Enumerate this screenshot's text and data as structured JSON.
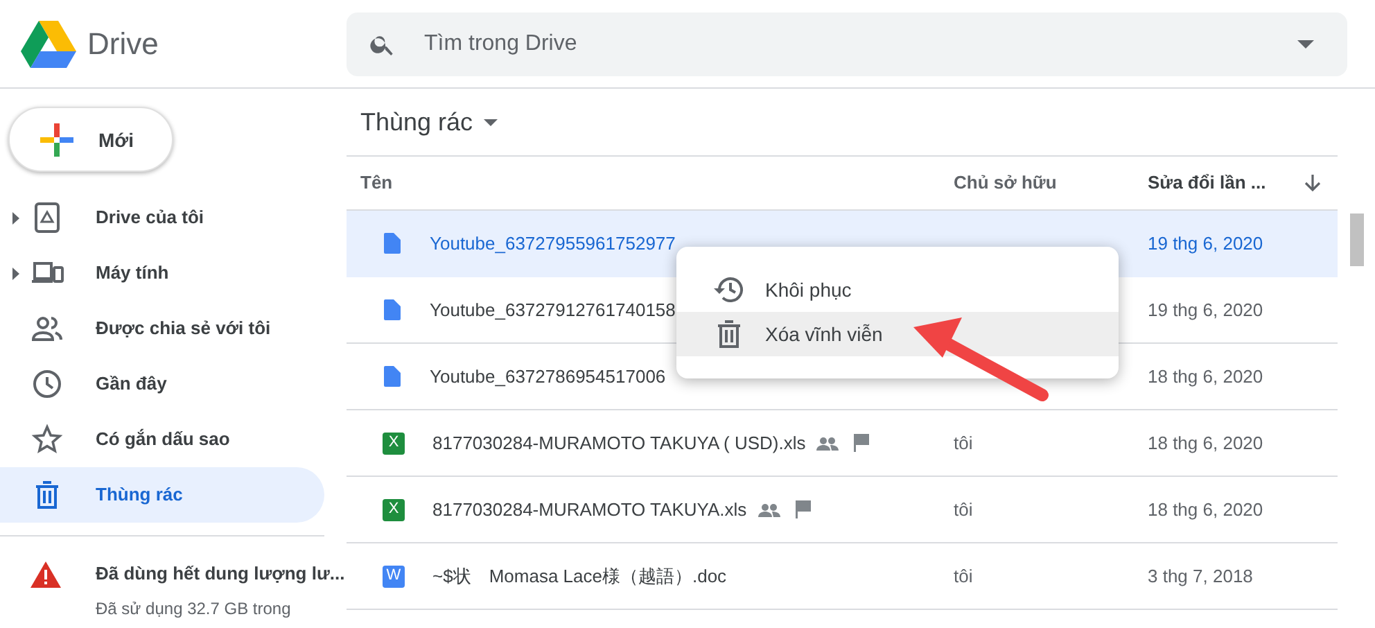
{
  "app": {
    "name": "Drive"
  },
  "search": {
    "placeholder": "Tìm trong Drive"
  },
  "new_button": {
    "label": "Mới"
  },
  "sidebar": {
    "items": [
      {
        "label": "Drive của tôi",
        "expandable": true,
        "selected": false
      },
      {
        "label": "Máy tính",
        "expandable": true,
        "selected": false
      },
      {
        "label": "Được chia sẻ với tôi",
        "expandable": false,
        "selected": false
      },
      {
        "label": "Gần đây",
        "expandable": false,
        "selected": false
      },
      {
        "label": "Có gắn dấu sao",
        "expandable": false,
        "selected": false
      },
      {
        "label": "Thùng rác",
        "expandable": false,
        "selected": true
      }
    ],
    "storage": {
      "warning": "Đã dùng hết dung lượng lư...",
      "usage": "Đã sử dụng 32.7 GB trong"
    }
  },
  "breadcrumb": {
    "title": "Thùng rác"
  },
  "table": {
    "columns": [
      "Tên",
      "Chủ sở hữu",
      "Sửa đổi lần ..."
    ],
    "rows": [
      {
        "kind": "doc",
        "name": "Youtube_63727955961752977",
        "owner": "",
        "modified": "19 thg 6, 2020",
        "selected": true,
        "shared": false,
        "flagged": false
      },
      {
        "kind": "doc",
        "name": "Youtube_63727912761740158",
        "owner": "",
        "modified": "19 thg 6, 2020",
        "selected": false,
        "shared": false,
        "flagged": false
      },
      {
        "kind": "doc",
        "name": "Youtube_6372786954517006",
        "owner": "",
        "modified": "18 thg 6, 2020",
        "selected": false,
        "shared": false,
        "flagged": false
      },
      {
        "kind": "sheet",
        "icon_text": "X",
        "name": "8177030284-MURAMOTO TAKUYA ( USD).xls",
        "owner": "tôi",
        "modified": "18 thg 6, 2020",
        "selected": false,
        "shared": true,
        "flagged": true
      },
      {
        "kind": "sheet",
        "icon_text": "X",
        "name": "8177030284-MURAMOTO TAKUYA.xls",
        "owner": "tôi",
        "modified": "18 thg 6, 2020",
        "selected": false,
        "shared": true,
        "flagged": true
      },
      {
        "kind": "word",
        "icon_text": "W",
        "name": "~$状　Momasa Lace様（越語）.doc",
        "owner": "tôi",
        "modified": "3 thg 7, 2018",
        "selected": false,
        "shared": false,
        "flagged": false
      }
    ]
  },
  "context_menu": {
    "items": [
      {
        "label": "Khôi phục",
        "hovered": false
      },
      {
        "label": "Xóa vĩnh viễn",
        "hovered": true
      }
    ]
  }
}
